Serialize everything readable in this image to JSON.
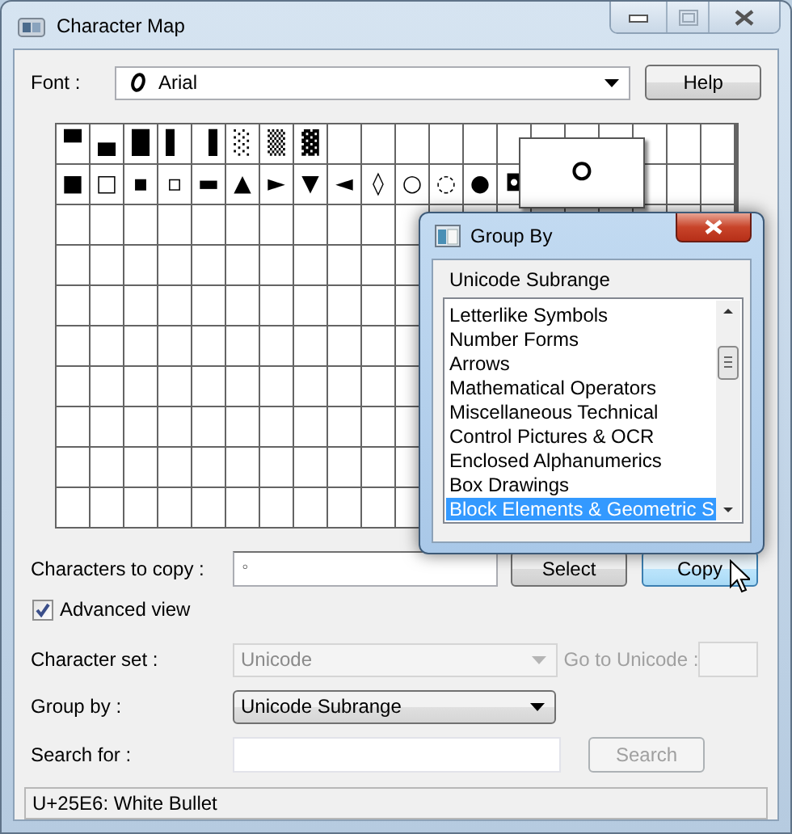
{
  "window": {
    "title": "Character Map"
  },
  "font": {
    "label": "Font :",
    "value": "Arial"
  },
  "help_button": {
    "label": "Help"
  },
  "character_grid": {
    "rows": [
      [
        "▀",
        "▄",
        "█",
        "▌",
        "▐",
        "░",
        "▒",
        "▓"
      ],
      [
        "■",
        "□",
        "▪",
        "▫",
        "▬",
        "▲",
        "►",
        "▼",
        "◄",
        "◊",
        "○",
        "◌",
        "●",
        "◘"
      ]
    ]
  },
  "magnified_character": "◦",
  "characters_to_copy": {
    "label": "Characters to copy :",
    "value": "◦"
  },
  "select_button": {
    "label": "Select"
  },
  "copy_button": {
    "label": "Copy",
    "hovered": true
  },
  "advanced_view": {
    "label": "Advanced view",
    "checked": true
  },
  "character_set": {
    "label": "Character set :",
    "value": "Unicode",
    "disabled": true
  },
  "go_to_unicode": {
    "label": "Go to Unicode :",
    "disabled": true
  },
  "group_by": {
    "label": "Group by :",
    "value": "Unicode Subrange"
  },
  "search_for": {
    "label": "Search for :"
  },
  "search_button": {
    "label": "Search",
    "disabled": true
  },
  "status_bar": "U+25E6: White Bullet",
  "group_by_dialog": {
    "title": "Group By",
    "heading": "Unicode Subrange",
    "items": [
      {
        "label": "Letterlike Symbols",
        "selected": false
      },
      {
        "label": "Number Forms",
        "selected": false
      },
      {
        "label": "Arrows",
        "selected": false
      },
      {
        "label": "Mathematical Operators",
        "selected": false
      },
      {
        "label": "Miscellaneous Technical",
        "selected": false
      },
      {
        "label": "Control Pictures & OCR",
        "selected": false
      },
      {
        "label": "Enclosed Alphanumerics",
        "selected": false
      },
      {
        "label": "Box Drawings",
        "selected": false
      },
      {
        "label": "Block Elements & Geometric S",
        "selected": true
      }
    ]
  }
}
